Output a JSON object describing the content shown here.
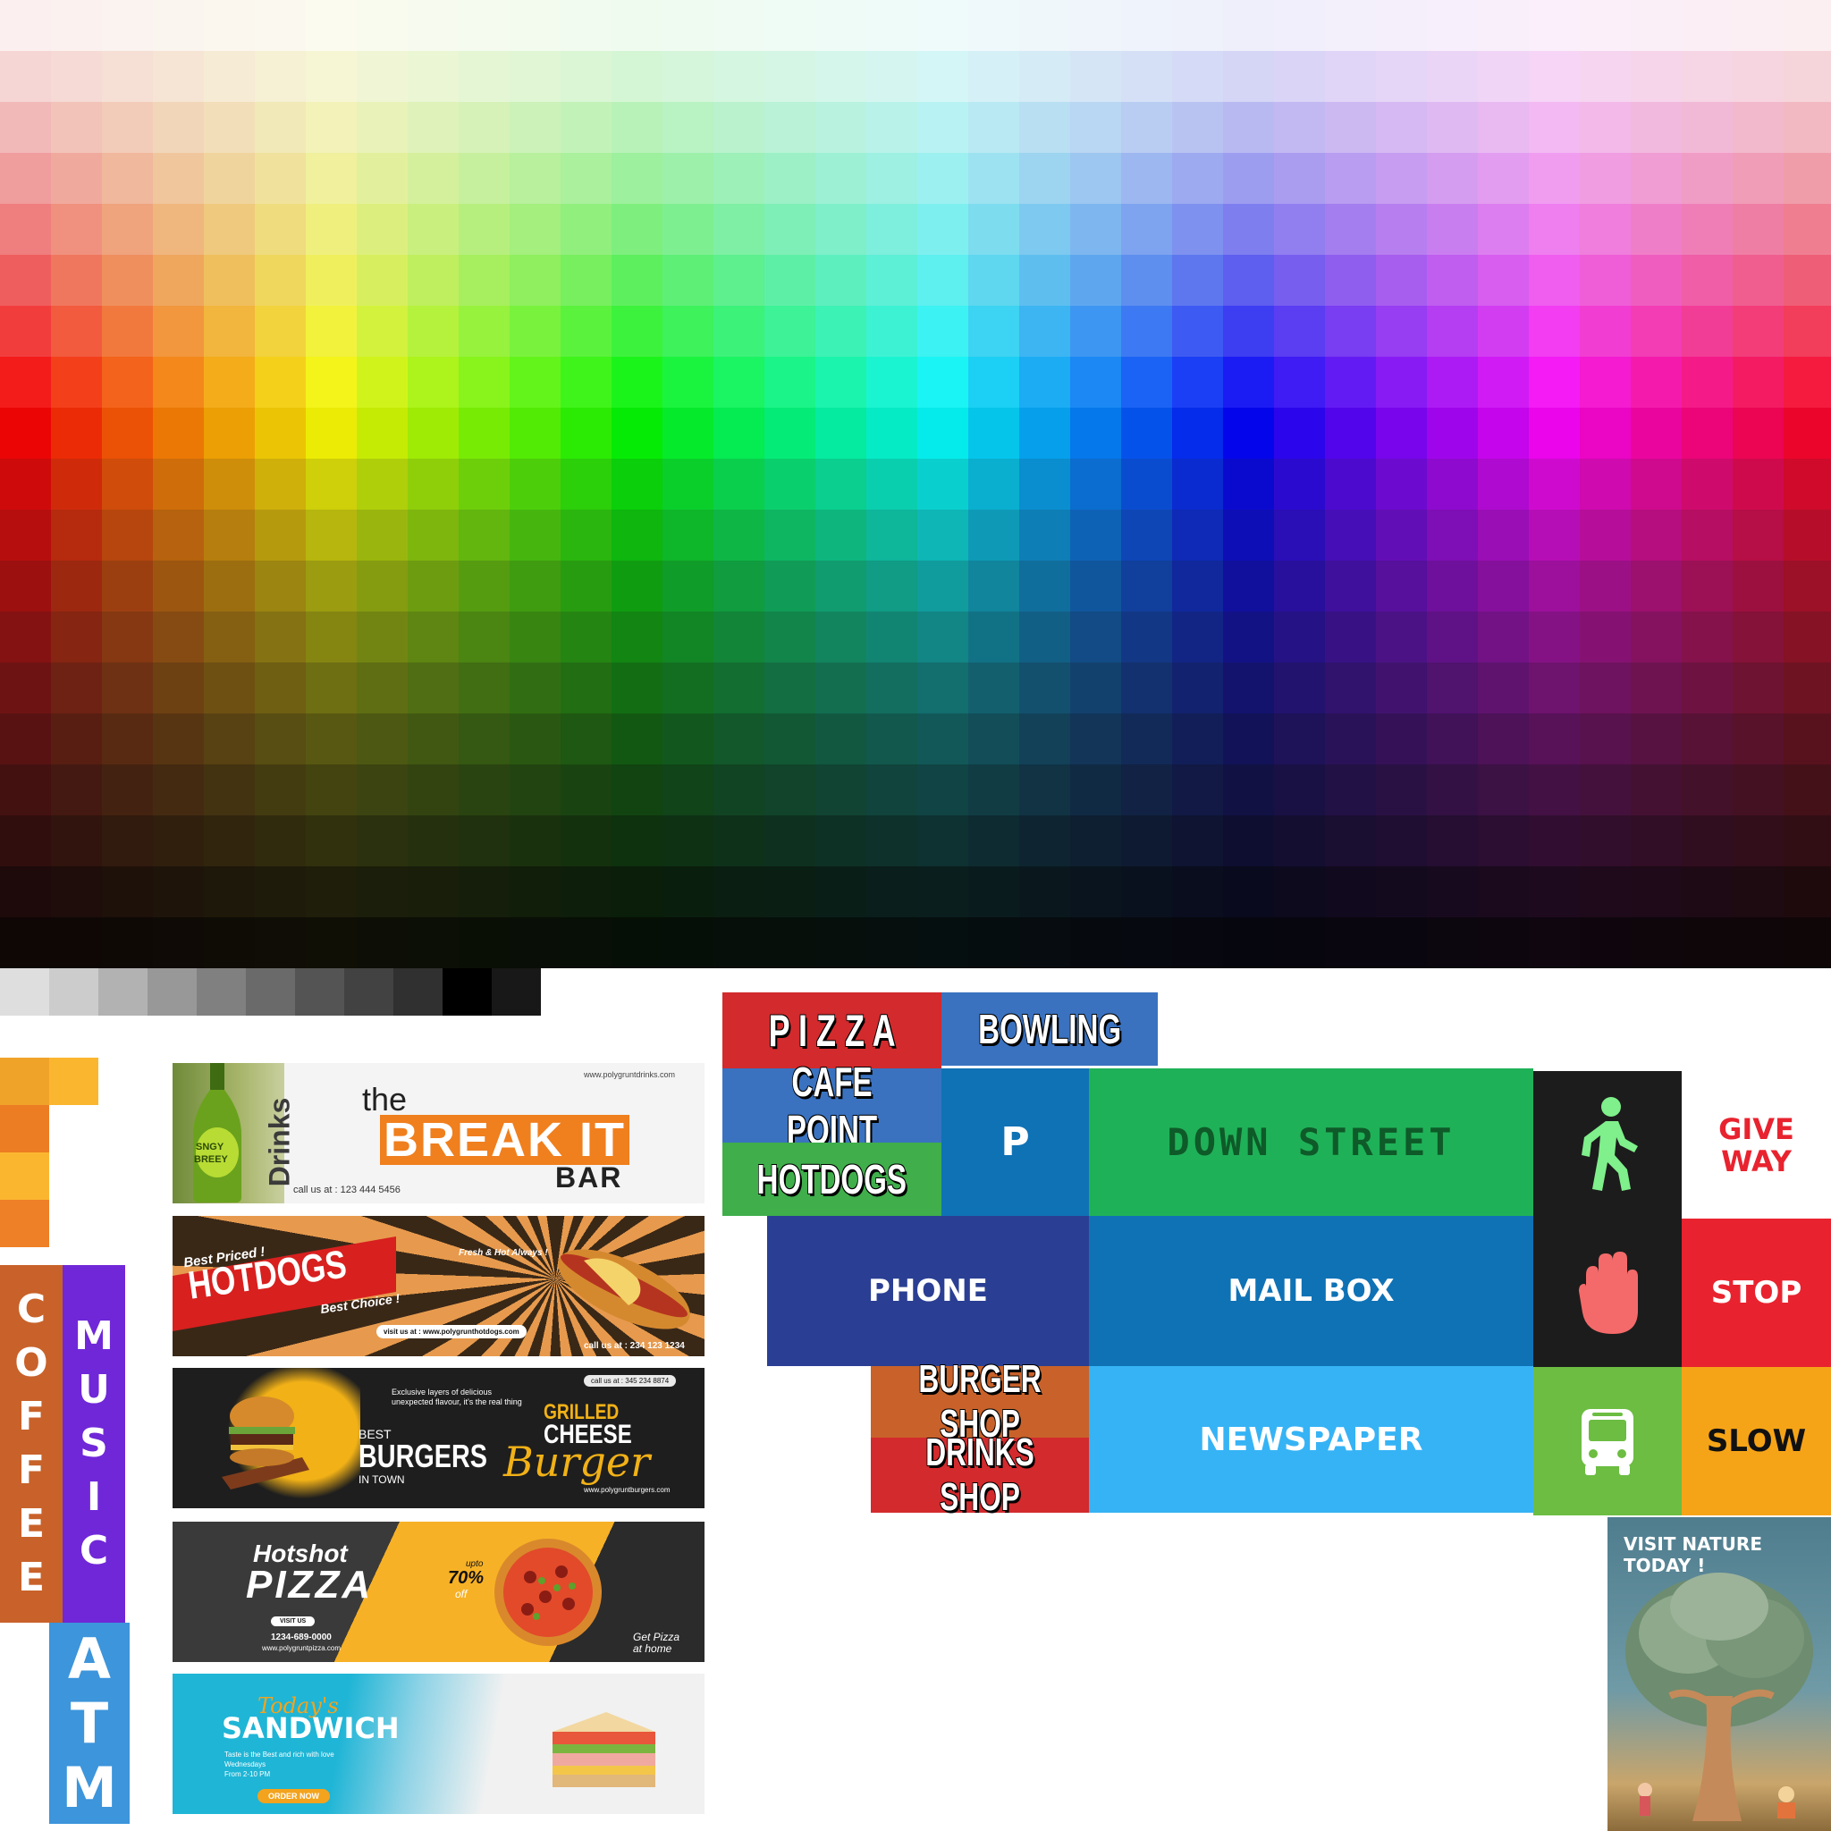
{
  "signs": {
    "pizza": "P I Z Z A",
    "bowling": "BOWLING",
    "cafe_point": "CAFE POINT",
    "hotdogs": "HOTDOGS",
    "parking": "P",
    "down_street": "DOWN STREET",
    "phone": "PHONE",
    "mail_box": "MAIL BOX",
    "burger_shop": "BURGER SHOP",
    "drinks_shop": "DRINKS SHOP",
    "newspaper": "NEWSPAPER",
    "give_way_1": "GIVE",
    "give_way_2": "WAY",
    "stop": "STOP",
    "slow": "SLOW"
  },
  "vertical_signs": {
    "coffee": [
      "C",
      "O",
      "F",
      "F",
      "E",
      "E"
    ],
    "music": [
      "M",
      "U",
      "S",
      "I",
      "C"
    ],
    "atm": [
      "A",
      "T",
      "M"
    ]
  },
  "banners": {
    "drinks": {
      "side_label": "Drinks",
      "bottle_label_1": "SNGY",
      "bottle_label_2": "BREEY",
      "url": "www.polygruntdrinks.com",
      "the": "the",
      "title": "BREAK IT",
      "bar": "BAR",
      "call": "call us at : 123 444 5456"
    },
    "hotdogs": {
      "best_priced": "Best Priced !",
      "title": "HOTDOGS",
      "best_choice": "Best Choice !",
      "fresh": "Fresh & Hot Always !",
      "visit": "visit us at : www.polygrunthotdogs.com",
      "call": "call us at : 234 123 1234"
    },
    "burgers": {
      "call": "call us at : 345 234 8874",
      "tagline": "Exclusive layers of delicious unexpected flavour, it's the real thing",
      "best": "BEST",
      "burgers": "BURGERS",
      "in_town": "IN TOWN",
      "grilled": "GRILLED",
      "cheese": "CHEESE",
      "burger_script": "Burger",
      "url": "www.polygruntburgers.com"
    },
    "pizza": {
      "hotshot": "Hotshot",
      "title": "PIZZA",
      "upto": "upto",
      "percent": "70%",
      "off": "off",
      "visit": "VISIT US",
      "phone": "1234-689-0000",
      "url": "www.polygruntpizza.com",
      "get_pizza_1": "Get Pizza",
      "get_pizza_2": "at home"
    },
    "sandwich": {
      "todays": "Today's",
      "title": "SANDWICH",
      "tagline_1": "Taste is the Best and rich with love",
      "tagline_2": "Wednesdays",
      "tagline_3": "From 2-10 PM",
      "order": "ORDER NOW"
    }
  },
  "poster": {
    "line1": "VISIT NATURE",
    "line2": "TODAY !"
  },
  "icons": {
    "pedestrian": "walking-person-icon",
    "hand": "stop-hand-icon",
    "bus": "bus-icon"
  },
  "colors": {
    "pizza_red": "#d32a2d",
    "bowling_blue": "#3a72c0",
    "hotdogs_green": "#3fae4b",
    "parking_blue": "#0f72b5",
    "down_street_green": "#1fb158",
    "phone_navy": "#2a3f93",
    "burger_orange": "#c8622a",
    "newspaper_sky": "#36b3f5",
    "stop_red": "#e8232f",
    "slow_amber": "#f6a417",
    "bus_green": "#6cbd42",
    "coffee_brown": "#c8622a",
    "music_purple": "#7027d8",
    "atm_blue": "#3d95db"
  }
}
